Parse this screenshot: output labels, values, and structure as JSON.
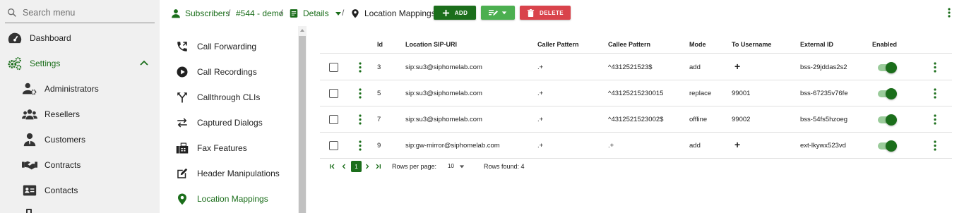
{
  "search": {
    "placeholder": "Search menu"
  },
  "sidebar": {
    "items": [
      {
        "label": "Dashboard",
        "icon": "dashboard-icon"
      },
      {
        "label": "Settings",
        "icon": "settings-icon",
        "expanded": true,
        "active": true
      },
      {
        "label": "Administrators",
        "icon": "admin-user-icon"
      },
      {
        "label": "Resellers",
        "icon": "resellers-icon"
      },
      {
        "label": "Customers",
        "icon": "customer-icon"
      },
      {
        "label": "Contracts",
        "icon": "handshake-icon"
      },
      {
        "label": "Contacts",
        "icon": "contact-card-icon"
      }
    ]
  },
  "breadcrumb": {
    "items": [
      {
        "label": "Subscribers",
        "icon": "person-icon"
      },
      {
        "label": "#544 - demo"
      },
      {
        "label": "Details",
        "icon": "details-doc-icon"
      },
      {
        "label": "Location Mappings",
        "icon": "location-pin-icon"
      }
    ],
    "separator": "/"
  },
  "toolbar": {
    "add_label": "ADD",
    "delete_label": "DELETE",
    "add_color": "#1b6e1b",
    "edit_color": "#4caf50",
    "delete_color": "#d9434b"
  },
  "submenu": {
    "items": [
      {
        "label": "Call Forwarding",
        "icon": "phone-forward-icon"
      },
      {
        "label": "Call Recordings",
        "icon": "play-circle-icon"
      },
      {
        "label": "Callthrough CLIs",
        "icon": "merge-icon"
      },
      {
        "label": "Captured Dialogs",
        "icon": "swap-arrows-icon"
      },
      {
        "label": "Fax Features",
        "icon": "fax-icon"
      },
      {
        "label": "Header Manipulations",
        "icon": "edit-square-icon"
      },
      {
        "label": "Location Mappings",
        "icon": "location-pin-icon",
        "active": true
      }
    ]
  },
  "table": {
    "headers": [
      "Id",
      "Location SIP-URI",
      "Caller Pattern",
      "Callee Pattern",
      "Mode",
      "To Username",
      "External ID",
      "Enabled"
    ],
    "rows": [
      {
        "id": "3",
        "uri": "sip:su3@siphomelab.com",
        "caller": ".+",
        "callee": "^4312521523$",
        "mode": "add",
        "to_username": "+",
        "external_id": "bss-29jddas2s2",
        "enabled": true
      },
      {
        "id": "5",
        "uri": "sip:su3@siphomelab.com",
        "caller": ".+",
        "callee": "^43125215230015",
        "mode": "replace",
        "to_username": "99001",
        "external_id": "bss-67235v76fe",
        "enabled": true
      },
      {
        "id": "7",
        "uri": "sip:su3@siphomelab.com",
        "caller": ".+",
        "callee": "^4312521523002$",
        "mode": "offline",
        "to_username": "99002",
        "external_id": "bss-54fs5hzoeg",
        "enabled": true
      },
      {
        "id": "9",
        "uri": "sip:gw-mirror@siphomelab.com",
        "caller": ".+",
        "callee": ".+",
        "mode": "add",
        "to_username": "+",
        "external_id": "ext-lkywx523vd",
        "enabled": true
      }
    ]
  },
  "pagination": {
    "current_page": "1",
    "rows_per_page_label": "Rows per page:",
    "rows_per_page": "10",
    "rows_found": "Rows found: 4"
  }
}
